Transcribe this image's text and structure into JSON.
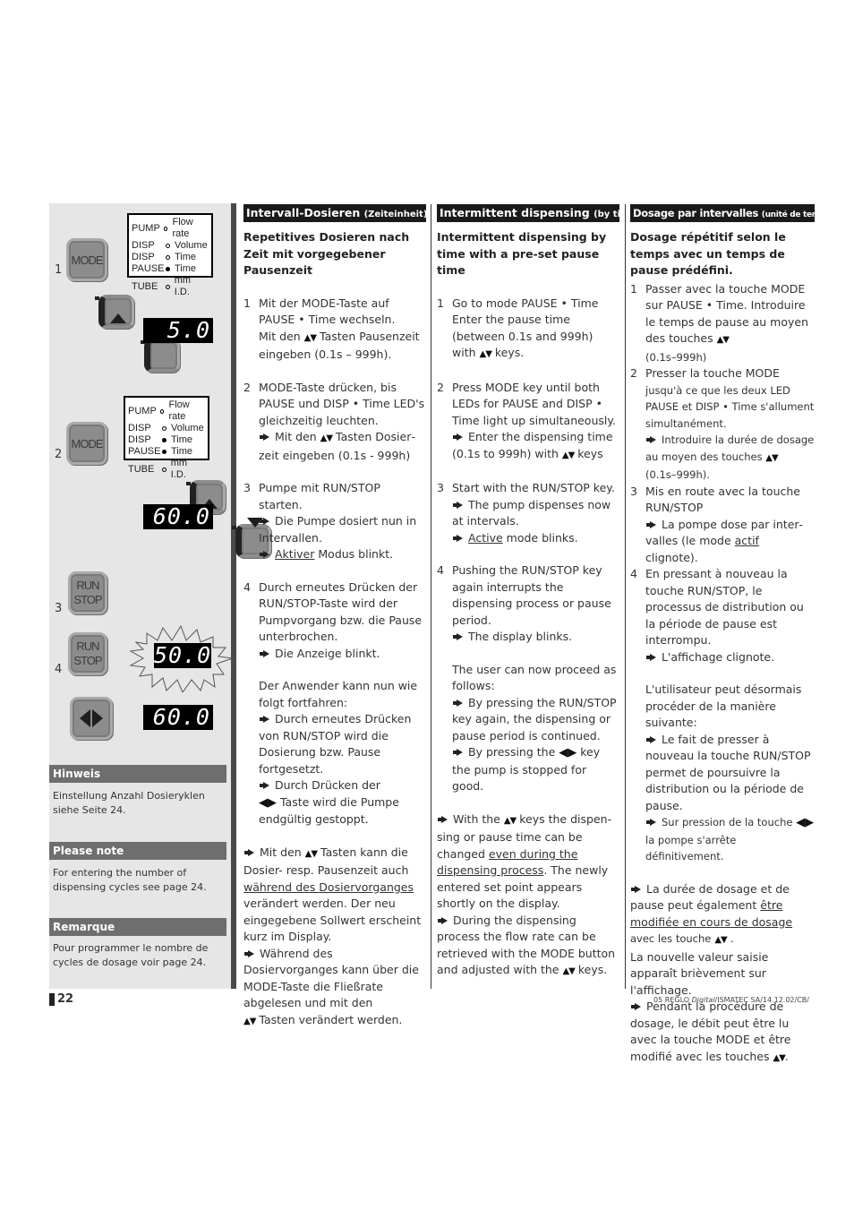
{
  "sidebar": {
    "step1": {
      "number": "1",
      "mode_key": "MODE",
      "up_key": "up",
      "down_key": "down",
      "display": "5.0",
      "leds": [
        {
          "name": "PUMP",
          "state": "off",
          "label": "Flow rate"
        },
        {
          "name": "DISP",
          "state": "off",
          "label": "Volume"
        },
        {
          "name": "DISP",
          "state": "off",
          "label": "Time"
        },
        {
          "name": "PAUSE",
          "state": "on",
          "label": "Time"
        },
        {
          "name": "TUBE",
          "state": "off",
          "label": "mm I.D."
        }
      ]
    },
    "step2": {
      "number": "2",
      "mode_key": "MODE",
      "display": "60.0",
      "leds": [
        {
          "name": "PUMP",
          "state": "off",
          "label": "Flow rate"
        },
        {
          "name": "DISP",
          "state": "off",
          "label": "Volume"
        },
        {
          "name": "DISP",
          "state": "on",
          "label": "Time"
        },
        {
          "name": "PAUSE",
          "state": "on",
          "label": "Time"
        },
        {
          "name": "TUBE",
          "state": "off",
          "label": "mm I.D."
        }
      ]
    },
    "step3": {
      "number": "3",
      "run": "RUN",
      "stop": "STOP"
    },
    "step4": {
      "number": "4",
      "run": "RUN",
      "stop": "STOP",
      "display": "50.0"
    },
    "step5": {
      "display": "60.0"
    },
    "notes": [
      {
        "title": "Hinweis",
        "text": "Einstellung Anzahl Dosieryklen siehe Seite 24."
      },
      {
        "title": "Please note",
        "text": "For entering the number of dispensing cycles see page 24."
      },
      {
        "title": "Remarque",
        "text": "Pour programmer le nombre de cycles de dosage voir page 24."
      }
    ]
  },
  "columns": {
    "de": {
      "title": "Intervall-Dosieren",
      "title_small": "(Zeiteinheit)",
      "subtitle": "Repetitives Dosieren nach Zeit mit vorgegebener Pausenzeit",
      "s1": {
        "n": "1",
        "a": "Mit der MODE-Taste auf PAUSE • Time wechseln.",
        "b": "Mit den",
        "c": "Tasten Pausenzeit eingeben (0.1s – 999h)."
      },
      "s2": {
        "n": "2",
        "a": "MODE-Taste drücken, bis PAUSE und DISP • Time LED's gleichzeitig leuchten.",
        "b": "Mit den",
        "c": "Tasten Dosier­zeit eingeben (0.1s - 999h)"
      },
      "s3": {
        "n": "3",
        "a": "Pumpe mit RUN/STOP starten.",
        "b": "Die Pumpe dosiert nun in Intervallen.",
        "c_u": "Aktiver",
        "c": "Modus blinkt."
      },
      "s4": {
        "n": "4",
        "a": "Durch erneutes Drücken der RUN/STOP-Taste wird der Pumpvorgang bzw. die Pause unterbrochen.",
        "b": "Die Anzeige blinkt.",
        "c": "Der Anwender kann nun wie folgt fortfahren:",
        "d": "Durch erneutes Drücken von RUN/STOP wird die Dosie­rung bzw. Pause fortgesetzt.",
        "e": "Durch Drücken der",
        "f": "Taste wird die Pumpe endgültig gestoppt."
      },
      "p1": {
        "a": "Mit den",
        "b": "Tasten kann die Dosier- resp. Pausenzeit auch",
        "u": "wäh­rend des Dosiervorganges",
        "c": "verän­dert werden. Der neu eingegebene Sollwert erscheint kurz im Display."
      },
      "p2": {
        "a": "Während des Dosiervorganges kann über die MODE-Taste die Fließrate abgelesen und mit den",
        "b": "Tasten verändert werden."
      }
    },
    "en": {
      "title": "Intermittent dispensing",
      "title_small": "(by time)",
      "subtitle": "Intermittent dispensing by time with a pre-set pause time",
      "s1": {
        "n": "1",
        "a": "Go to mode PAUSE • Time Enter the pause time (between 0.1s and 999h) with",
        "b": "keys."
      },
      "s2": {
        "n": "2",
        "a": "Press MODE key until both LEDs for PAUSE and DISP • Time light up simultaneously.",
        "b": "Enter the dispensing time (0.1s to 999h) with",
        "c": "keys"
      },
      "s3": {
        "n": "3",
        "a": "Start with the RUN/STOP key.",
        "b": "The pump dispenses now at intervals.",
        "c_u": "Active",
        "c": "mode blinks."
      },
      "s4": {
        "n": "4",
        "a": "Pushing the RUN/STOP key again interrupts the dispensing process or pause period.",
        "b": "The display blinks.",
        "c": "The user can now proceed as follows:",
        "d": "By pressing the RUN/STOP key again, the dispensing or pause period is continued.",
        "e": "By pressing the",
        "f": "key the pump is stopped for good."
      },
      "p1": {
        "a": "With the",
        "b": "keys the dispen­sing or pause time can be changed",
        "u": "even during the dispensing process",
        "c": ". The newly entered set point appears shortly on the display."
      },
      "p2": {
        "a": "During the dispensing process the flow rate can be retrieved with the MODE button and adjusted with the",
        "b": "keys."
      }
    },
    "fr": {
      "title": "Dosage par intervalles",
      "title_small": "(unité de temps)",
      "subtitle": "Dosage répétitif selon le temps avec un temps de pause prédéfini.",
      "s1": {
        "n": "1",
        "a": "Passer avec la touche MODE sur PAUSE • Time. Introduire le temps de pause au moyen des touches",
        "b": "(0.1s–999h)"
      },
      "s2": {
        "n": "2",
        "a": "Presser la touche MODE",
        "a2": "jusqu'à ce que les deux LED PAUSE et DISP • Time s'allument simultanément.",
        "b": "Introduire la durée de dosage au moyen des touches",
        "c": "(0.1s–999h)."
      },
      "s3": {
        "n": "3",
        "a": "Mis en route avec la touche RUN/STOP",
        "b": "La pompe dose par inter­valles (le mode",
        "b_u": "actif",
        "b2": "clignote)."
      },
      "s4": {
        "n": "4",
        "a": "En pressant à nouveau la touche RUN/STOP, le processus de distribution ou la période de pause est interrompu.",
        "b": "L'affichage clignote.",
        "c": "L'utilisateur peut désormais pro­céder de la manière suivante:",
        "d": "Le fait de presser à nouveau la touche RUN/STOP permet de poursuivre la distribution ou la période de pause.",
        "e": "Sur pression de la touche",
        "f": "la pompe s'arrête définitivement."
      },
      "p1": {
        "a": "La durée de dosage et de pause peut également",
        "u": "être modifiée en cours de dosage",
        "b": "avec les touche",
        "c": ".",
        "d": "La nouvelle valeur saisie apparaît brièvement sur l'affichage."
      },
      "p2": {
        "a": "Pendant la procédure de dosage, le débit peut être lu avec la touche MODE et  être modifié avec les touches",
        "b": "."
      }
    }
  },
  "symbols": {
    "updown": "▲▼",
    "leftright": "◀▶"
  },
  "footer": {
    "page_number": "22",
    "reference_prefix": "05 REGLO ",
    "reference_italic": "Digital",
    "reference_suffix": "/ISMATEC SA/14.12.02/CB/"
  }
}
